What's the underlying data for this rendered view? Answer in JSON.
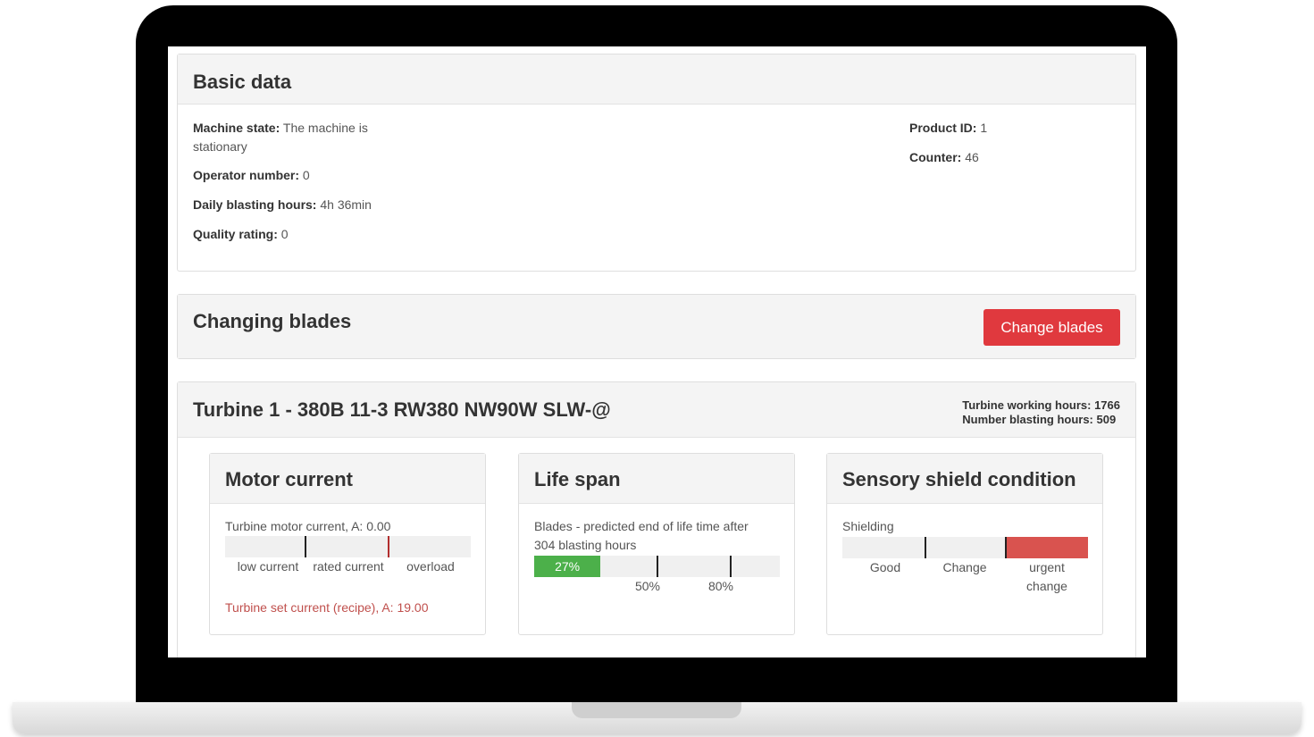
{
  "basic": {
    "title": "Basic data",
    "machine_state_label": "Machine state:",
    "machine_state_value": "The machine is",
    "machine_state_value2": "stationary",
    "operator_label": "Operator number:",
    "operator_value": "0",
    "daily_label": "Daily blasting hours:",
    "daily_value": "4h 36min",
    "quality_label": "Quality rating:",
    "quality_value": "0",
    "product_label": "Product ID:",
    "product_value": "1",
    "counter_label": "Counter:",
    "counter_value": "46"
  },
  "changing": {
    "title": "Changing blades",
    "button_label": "Change blades",
    "button_color": "#e0393e"
  },
  "turbine": {
    "title": "Turbine 1 - 380B 11-3 RW380 NW90W SLW-@",
    "working_hours": "Turbine working hours: 1766",
    "blasting_hours": "Number blasting hours: 509"
  },
  "motor": {
    "title": "Motor current",
    "reading": "Turbine motor current, A: 0.00",
    "labels": [
      "low current",
      "rated current",
      "overload"
    ],
    "set_current": "Turbine set current (recipe), A: 19.00"
  },
  "lifespan": {
    "title": "Life span",
    "desc_line1": "Blades - predicted end of life time after",
    "desc_line2": "304 blasting hours",
    "progress_label": "27%",
    "progress_value": 27,
    "marks": [
      "50%",
      "80%"
    ],
    "fill_color": "#4cb04a"
  },
  "shield": {
    "title": "Sensory shield condition",
    "label": "Shielding",
    "levels": [
      "Good",
      "Change",
      "urgent",
      "change"
    ],
    "level_color": "#d9534f"
  }
}
